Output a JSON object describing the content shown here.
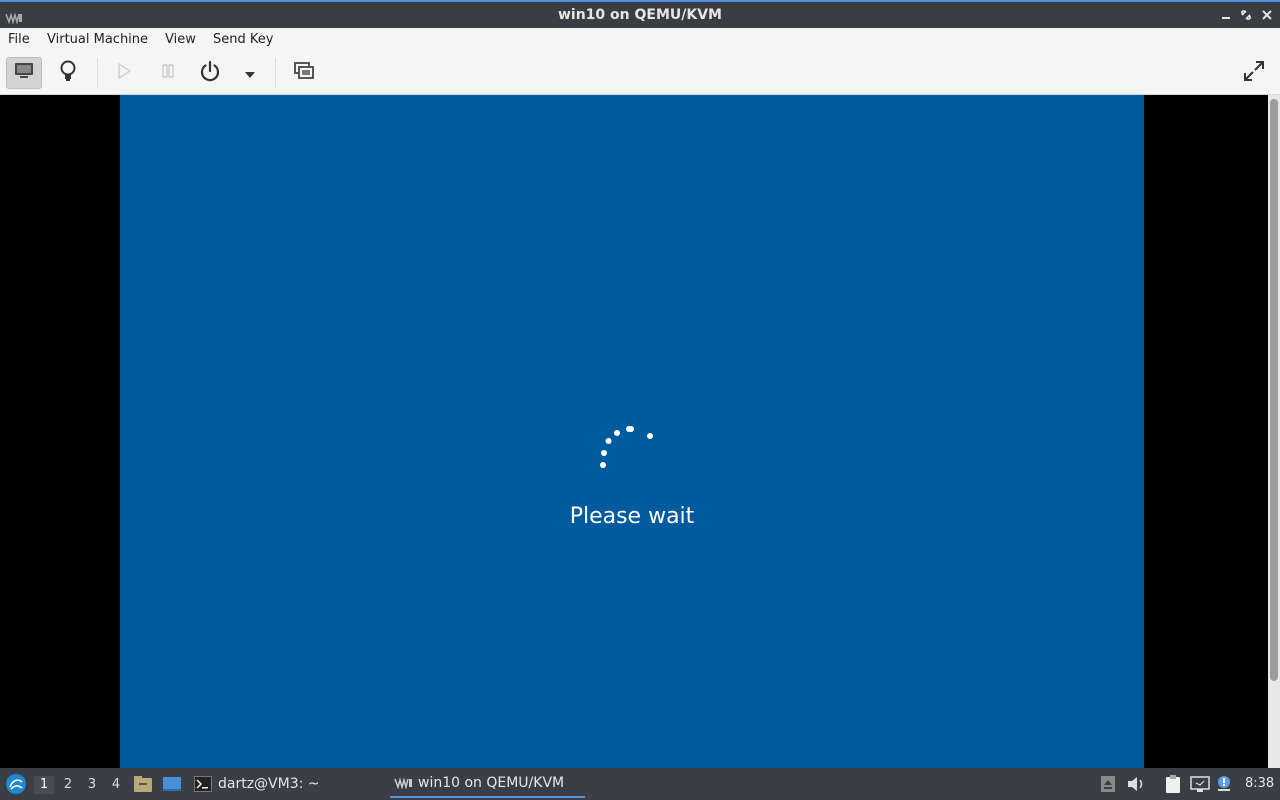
{
  "window": {
    "title": "win10 on QEMU/KVM"
  },
  "menu": {
    "items": [
      "File",
      "Virtual Machine",
      "View",
      "Send Key"
    ]
  },
  "toolbar": {
    "buttons": [
      {
        "name": "console-button",
        "icon": "monitor-icon",
        "active": true
      },
      {
        "name": "details-button",
        "icon": "lightbulb-icon"
      },
      {
        "name": "run-button",
        "icon": "play-icon",
        "disabled": true
      },
      {
        "name": "pause-button",
        "icon": "pause-icon",
        "disabled": true
      },
      {
        "name": "shutdown-button",
        "icon": "power-icon"
      },
      {
        "name": "shutdown-menu-button",
        "icon": "chevron-down-icon"
      },
      {
        "name": "snapshots-button",
        "icon": "snapshot-icon"
      },
      {
        "name": "fullscreen-button",
        "icon": "fullscreen-icon"
      }
    ]
  },
  "vm_display": {
    "message": "Please wait",
    "background": "#005a9e"
  },
  "taskbar": {
    "workspaces": [
      "1",
      "2",
      "3",
      "4"
    ],
    "active_workspace": "1",
    "tasks": [
      {
        "label": "dartz@VM3: ~",
        "icon": "terminal-icon"
      },
      {
        "label": "win10 on QEMU/KVM",
        "icon": "virt-manager-icon",
        "active": true
      }
    ],
    "clock": "8:38"
  },
  "colors": {
    "accent": "#5294e2",
    "titlebar": "#3a3d42",
    "taskbar": "#3b3e45"
  }
}
